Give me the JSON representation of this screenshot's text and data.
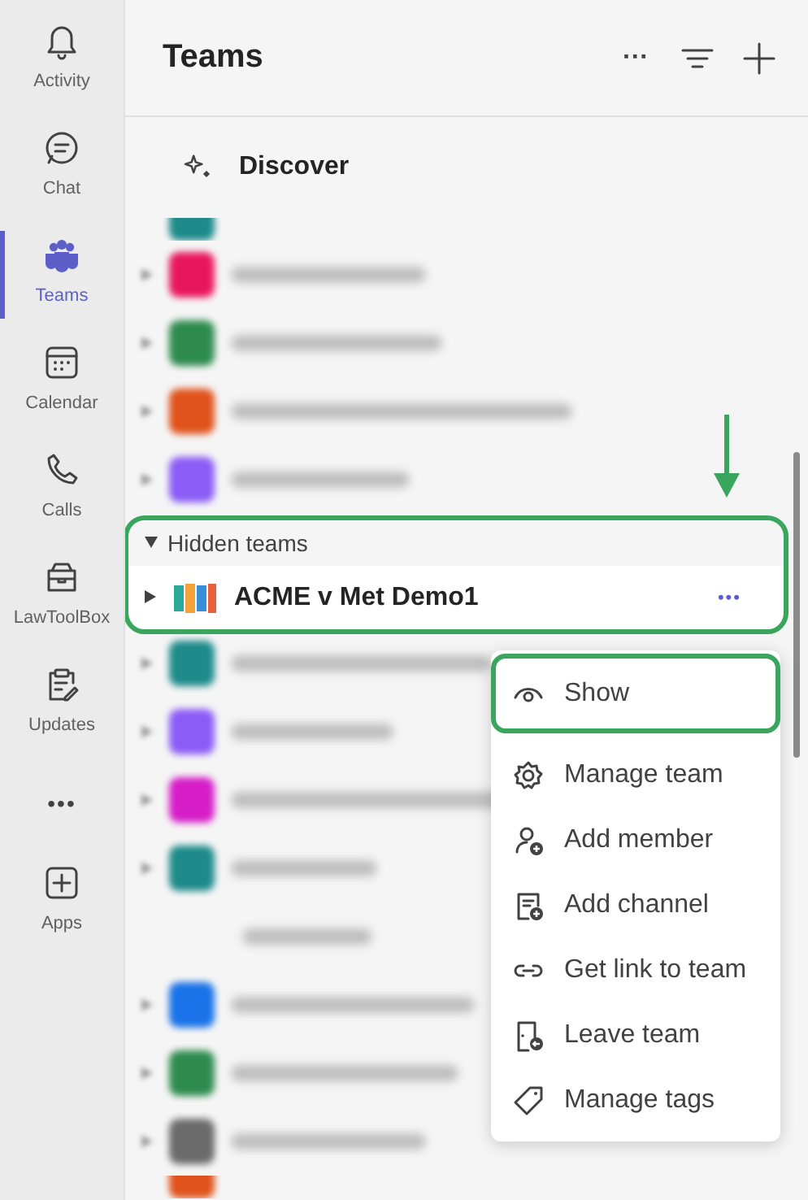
{
  "rail": [
    {
      "label": "Activity",
      "selected": false
    },
    {
      "label": "Chat",
      "selected": false
    },
    {
      "label": "Teams",
      "selected": true
    },
    {
      "label": "Calendar",
      "selected": false
    },
    {
      "label": "Calls",
      "selected": false
    },
    {
      "label": "LawToolBox",
      "selected": false
    },
    {
      "label": "Updates",
      "selected": false
    },
    {
      "label": "•••",
      "selected": false
    },
    {
      "label": "Apps",
      "selected": false
    }
  ],
  "header": {
    "title": "Teams",
    "more": "···"
  },
  "discover": {
    "label": "Discover"
  },
  "teams_top": [
    {
      "kind": "partial",
      "color": "#1e8a8a"
    },
    {
      "kind": "team",
      "color": "#e8175d"
    },
    {
      "kind": "team",
      "color": "#2e8b4e"
    },
    {
      "kind": "team",
      "color": "#e0531c"
    },
    {
      "kind": "team",
      "color": "#8b5cf6"
    }
  ],
  "hidden_teams": {
    "label": "Hidden teams",
    "expanded": true,
    "highlighted": true,
    "team": {
      "name": "ACME v Met Demo1",
      "more": "•••"
    }
  },
  "teams_bottom": [
    {
      "kind": "team",
      "color": "#1e8a8a"
    },
    {
      "kind": "team",
      "color": "#8b5cf6"
    },
    {
      "kind": "team",
      "color": "#d61ec8"
    },
    {
      "kind": "team",
      "color": "#1e8a8a"
    },
    {
      "kind": "channel"
    },
    {
      "kind": "team",
      "color": "#1a73e8"
    },
    {
      "kind": "team",
      "color": "#2e8b4e"
    },
    {
      "kind": "team",
      "color": "#6b6b6b"
    },
    {
      "kind": "partial",
      "color": "#e0531c"
    }
  ],
  "menu": [
    {
      "label": "Show",
      "highlighted": true
    },
    {
      "label": "Manage team",
      "highlighted": false
    },
    {
      "label": "Add member",
      "highlighted": false
    },
    {
      "label": "Add channel",
      "highlighted": false
    },
    {
      "label": "Get link to team",
      "highlighted": false
    },
    {
      "label": "Leave team",
      "highlighted": false
    },
    {
      "label": "Manage tags",
      "highlighted": false
    }
  ],
  "pointer_arrow": true
}
